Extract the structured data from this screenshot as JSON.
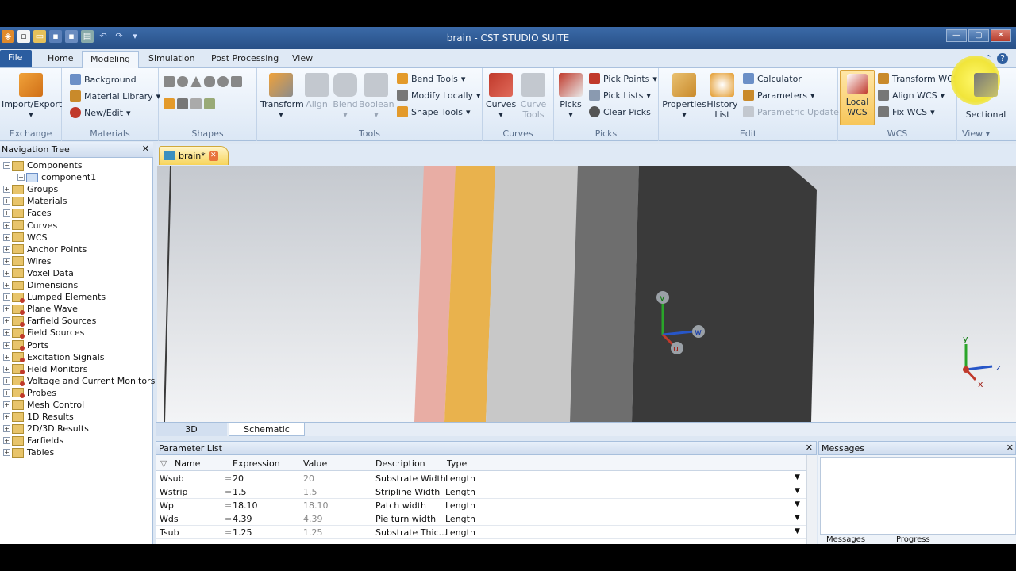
{
  "window": {
    "title": "brain - CST STUDIO SUITE"
  },
  "menu_tabs": [
    "File",
    "Home",
    "Modeling",
    "Simulation",
    "Post Processing",
    "View"
  ],
  "ribbon": {
    "exchange": {
      "label": "Exchange",
      "import_export": "Import/Export"
    },
    "materials": {
      "label": "Materials",
      "background": "Background",
      "material_library": "Material Library",
      "new_edit": "New/Edit"
    },
    "shapes": {
      "label": "Shapes"
    },
    "tools": {
      "label": "Tools",
      "transform": "Transform",
      "align": "Align",
      "blend": "Blend",
      "boolean": "Boolean",
      "bend_tools": "Bend Tools",
      "modify_locally": "Modify Locally",
      "shape_tools": "Shape Tools"
    },
    "curves": {
      "label": "Curves",
      "curves": "Curves",
      "curve_tools": "Curve Tools"
    },
    "picks": {
      "label": "Picks",
      "picks": "Picks",
      "pick_points": "Pick Points",
      "pick_lists": "Pick Lists",
      "clear_picks": "Clear Picks"
    },
    "edit": {
      "label": "Edit",
      "properties": "Properties",
      "history_list": "History List",
      "calculator": "Calculator",
      "parameters": "Parameters",
      "parametric_update": "Parametric Update"
    },
    "wcs": {
      "label": "WCS",
      "local_wcs": "Local WCS",
      "transform_wcs": "Transform WCS",
      "align_wcs": "Align WCS",
      "fix_wcs": "Fix WCS"
    },
    "view": {
      "label": "View",
      "sectional": "Sectional"
    }
  },
  "nav": {
    "title": "Navigation Tree",
    "items": [
      {
        "label": "Components",
        "expanded": true
      },
      {
        "label": "component1",
        "child": true
      },
      {
        "label": "Groups"
      },
      {
        "label": "Materials"
      },
      {
        "label": "Faces"
      },
      {
        "label": "Curves"
      },
      {
        "label": "WCS"
      },
      {
        "label": "Anchor Points"
      },
      {
        "label": "Wires"
      },
      {
        "label": "Voxel Data"
      },
      {
        "label": "Dimensions"
      },
      {
        "label": "Lumped Elements"
      },
      {
        "label": "Plane Wave"
      },
      {
        "label": "Farfield Sources"
      },
      {
        "label": "Field Sources"
      },
      {
        "label": "Ports"
      },
      {
        "label": "Excitation Signals"
      },
      {
        "label": "Field Monitors"
      },
      {
        "label": "Voltage and Current Monitors"
      },
      {
        "label": "Probes"
      },
      {
        "label": "Mesh Control"
      },
      {
        "label": "1D Results"
      },
      {
        "label": "2D/3D Results"
      },
      {
        "label": "Farfields"
      },
      {
        "label": "Tables"
      }
    ]
  },
  "document_tab": "brain*",
  "view_tabs": [
    "3D",
    "Schematic"
  ],
  "axes": {
    "local": {
      "v": "v",
      "w": "w",
      "u": "u"
    },
    "global": {
      "y": "y",
      "z": "z",
      "x": "x"
    }
  },
  "parameters": {
    "title": "Parameter List",
    "columns": [
      "Name",
      "Expression",
      "Value",
      "Description",
      "Type"
    ],
    "rows": [
      {
        "name": "Wsub",
        "expression": "20",
        "value": "20",
        "description": "Substrate Width",
        "type": "Length"
      },
      {
        "name": "Wstrip",
        "expression": "1.5",
        "value": "1.5",
        "description": "Stripline Width",
        "type": "Length"
      },
      {
        "name": "Wp",
        "expression": "18.10",
        "value": "18.10",
        "description": "Patch width",
        "type": "Length"
      },
      {
        "name": "Wds",
        "expression": "4.39",
        "value": "4.39",
        "description": "Pie turn width",
        "type": "Length"
      },
      {
        "name": "Tsub",
        "expression": "1.25",
        "value": "1.25",
        "description": "Substrate Thic...",
        "type": "Length"
      }
    ]
  },
  "messages": {
    "title": "Messages",
    "tabs": [
      "Messages",
      "Progress"
    ]
  }
}
